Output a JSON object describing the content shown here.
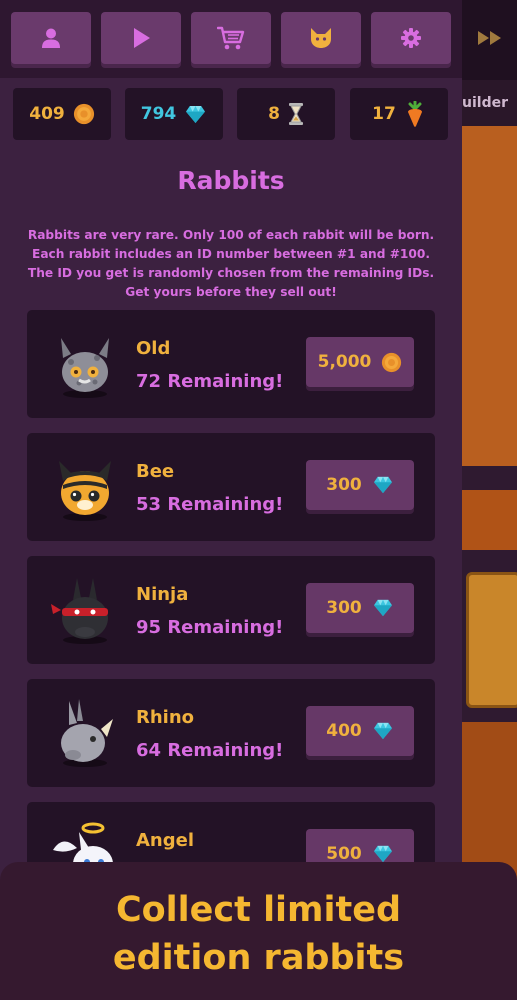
{
  "toolbar": {
    "buttons": [
      {
        "icon": "person-icon"
      },
      {
        "icon": "play-icon"
      },
      {
        "icon": "cart-icon"
      },
      {
        "icon": "cat-face-icon"
      },
      {
        "icon": "gear-icon"
      }
    ],
    "fast_forward_icon": "fast-forward-icon"
  },
  "background": {
    "side_label": "uilder"
  },
  "stats": {
    "coins": "409",
    "gems": "794",
    "hourglass": "8",
    "carrots": "17"
  },
  "shop": {
    "title": "Rabbits",
    "description": "Rabbits are very rare. Only 100 of each rabbit will be born. Each rabbit includes an ID number between #1 and #100. The ID you get is randomly chosen from the remaining IDs. Get yours before they sell out!",
    "items": [
      {
        "name": "Old",
        "remaining": "72 Remaining!",
        "price": "5,000",
        "currency": "coin"
      },
      {
        "name": "Bee",
        "remaining": "53 Remaining!",
        "price": "300",
        "currency": "gem"
      },
      {
        "name": "Ninja",
        "remaining": "95 Remaining!",
        "price": "300",
        "currency": "gem"
      },
      {
        "name": "Rhino",
        "remaining": "64 Remaining!",
        "price": "400",
        "currency": "gem"
      },
      {
        "name": "Angel",
        "remaining": "",
        "price": "500",
        "currency": "gem"
      }
    ]
  },
  "banner": {
    "line1": "Collect limited",
    "line2": "edition rabbits"
  },
  "colors": {
    "accent_gold": "#f0b13e",
    "accent_pink": "#d86de0",
    "gem_cyan": "#41c6e0",
    "button_purple": "#6a3a6c"
  }
}
